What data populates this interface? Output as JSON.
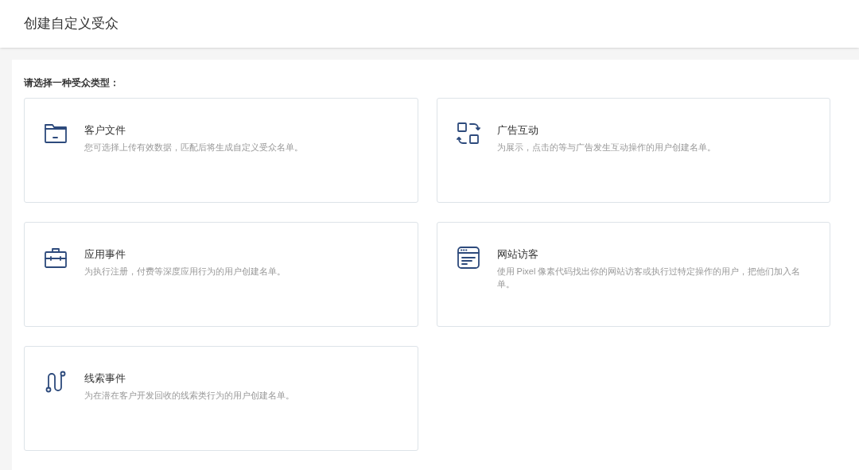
{
  "header": {
    "title": "创建自定义受众"
  },
  "prompt": "请选择一种受众类型：",
  "options": [
    {
      "kind": "folder",
      "title": "客户文件",
      "description": "您可选择上传有效数据，匹配后将生成自定义受众名单。"
    },
    {
      "kind": "exchange",
      "title": "广告互动",
      "description": "为展示，点击的等与广告发生互动操作的用户创建名单。"
    },
    {
      "kind": "briefcase",
      "title": "应用事件",
      "description": "为执行注册，付费等深度应用行为的用户创建名单。"
    },
    {
      "kind": "browser",
      "title": "网站访客",
      "description": "使用 Pixel 像素代码找出你的网站访客或执行过特定操作的用户，把他们加入名单。"
    },
    {
      "kind": "route",
      "title": "线索事件",
      "description": "为在潜在客户开发回收的线索类行为的用户创建名单。"
    }
  ]
}
